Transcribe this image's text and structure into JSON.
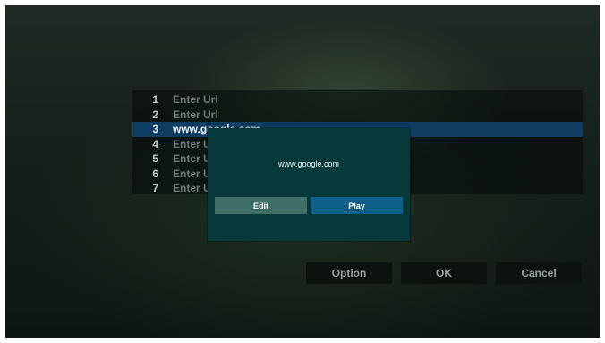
{
  "url_list": {
    "items": [
      {
        "number": "1",
        "url": "Enter Url"
      },
      {
        "number": "2",
        "url": "Enter Url"
      },
      {
        "number": "3",
        "url": "www.google.com"
      },
      {
        "number": "4",
        "url": "Enter Url"
      },
      {
        "number": "5",
        "url": "Enter Url"
      },
      {
        "number": "6",
        "url": "Enter Url"
      },
      {
        "number": "7",
        "url": "Enter Url"
      }
    ],
    "selected_index": 2
  },
  "dialog": {
    "url_text": "www.google.com",
    "edit_label": "Edit",
    "play_label": "Play"
  },
  "buttons": {
    "option_label": "Option",
    "ok_label": "OK",
    "cancel_label": "Cancel"
  },
  "colors": {
    "selected_row": "#0f3c61",
    "dialog_bg": "#08393a",
    "edit_button": "#3f6f67",
    "play_button": "#0f5f8c"
  }
}
